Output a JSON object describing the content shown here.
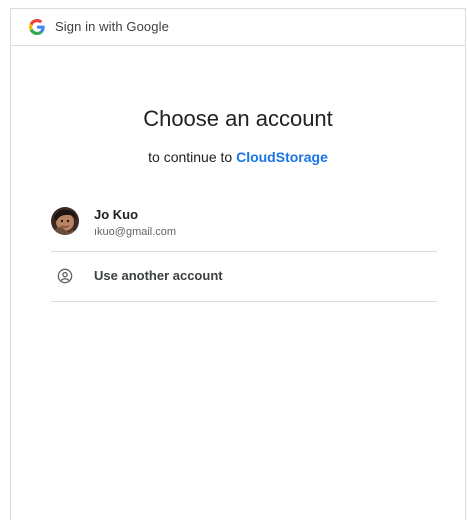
{
  "header": {
    "title": "Sign in with Google",
    "logo_icon": "google-g-icon"
  },
  "main": {
    "heading": "Choose an account",
    "subheading_prefix": "to continue to",
    "app_name": "CloudStorage"
  },
  "accounts": [
    {
      "name": "Jo Kuo",
      "email": "ıkuo@gmail.com",
      "avatar": "avatar-photo"
    }
  ],
  "other_account": {
    "label": "Use another account",
    "icon": "account-circle-icon"
  },
  "colors": {
    "accent": "#1a73e8",
    "divider": "#dadce0",
    "text": "#202124",
    "secondary_text": "#5f6368"
  }
}
